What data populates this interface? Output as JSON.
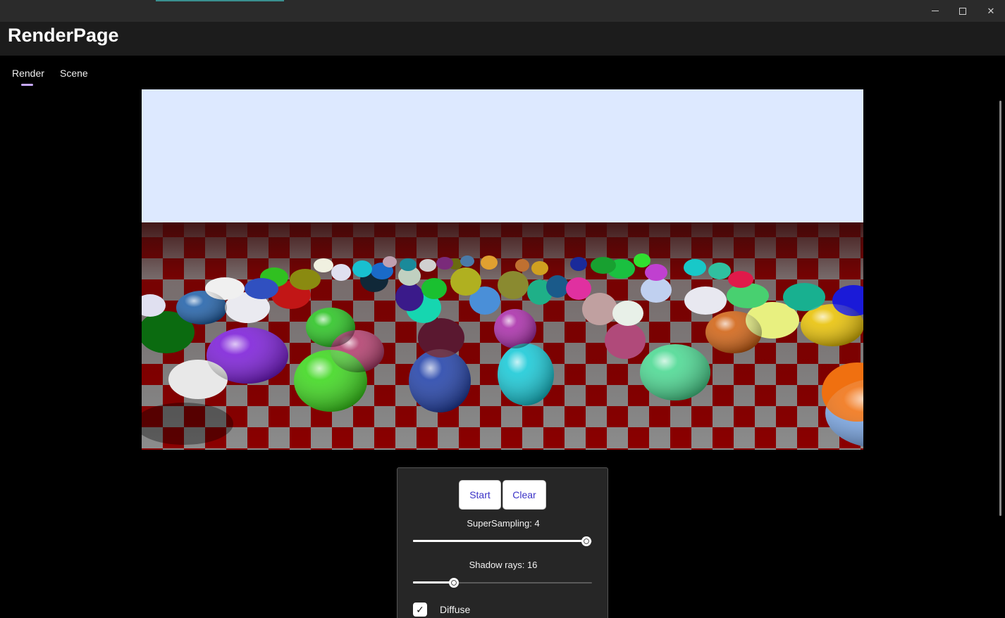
{
  "window": {
    "controls": {
      "minimize_icon": "minimize-icon",
      "maximize_icon": "maximize-icon",
      "close_icon": "close-icon",
      "close_glyph": "✕"
    }
  },
  "header": {
    "title": "RenderPage"
  },
  "tabs": [
    {
      "label": "Render",
      "selected": true
    },
    {
      "label": "Scene",
      "selected": false
    }
  ],
  "render": {
    "sky_color": "#dde9ff",
    "floor_red": "#8b0000",
    "floor_gray": "#8c8c8c"
  },
  "controls": {
    "start_label": "Start",
    "clear_label": "Clear",
    "supersampling_label": "SuperSampling: 4",
    "supersampling_fraction": 0.97,
    "shadow_rays_label": "Shadow rays: 16",
    "shadow_rays_fraction": 0.23,
    "diffuse_label": "Diffuse",
    "diffuse_checked": true,
    "accent_color": "#3b33c7",
    "tab_indicator_color": "#c7a8ff"
  }
}
